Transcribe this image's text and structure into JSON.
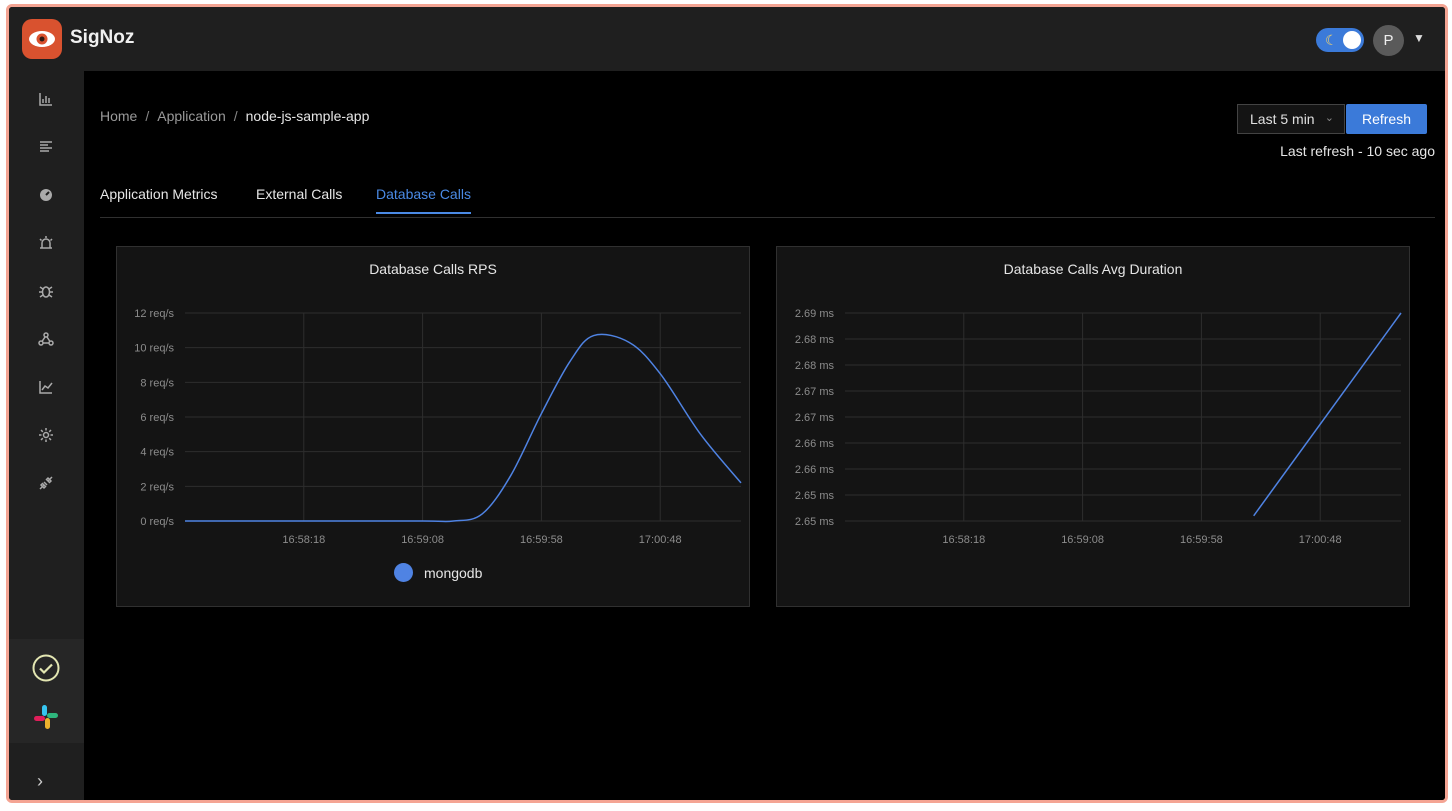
{
  "app": {
    "name": "SigNoz",
    "user_initial": "P"
  },
  "icons": {
    "logo": "eye-logo-icon",
    "theme_toggle": "moon-icon",
    "sidebar": [
      "bar-chart-icon",
      "list-icon",
      "dashboard-icon",
      "alert-icon",
      "bug-icon",
      "service-map-icon",
      "line-chart-icon",
      "settings-icon",
      "api-icon"
    ],
    "sidebar_bottom": [
      "check-circle-icon",
      "slack-icon",
      "chevron-right-icon"
    ]
  },
  "breadcrumb": [
    "Home",
    "Application",
    "node-js-sample-app"
  ],
  "time_range": {
    "selected": "Last 5 min",
    "refresh_label": "Refresh",
    "last_refresh": "Last refresh - 10 sec ago"
  },
  "tabs": [
    {
      "label": "Application Metrics",
      "active": false
    },
    {
      "label": "External Calls",
      "active": false
    },
    {
      "label": "Database Calls",
      "active": true
    }
  ],
  "colors": {
    "accent": "#3b7ad9",
    "series": "#4f83e3",
    "brand": "#d9522f"
  },
  "chart_data": [
    {
      "type": "line",
      "title": "Database Calls RPS",
      "y_ticks": [
        "0 req/s",
        "2 req/s",
        "4 req/s",
        "6 req/s",
        "8 req/s",
        "10 req/s",
        "12 req/s"
      ],
      "x_ticks": [
        "16:58:18",
        "16:59:08",
        "16:59:58",
        "17:00:48"
      ],
      "ylim": [
        0,
        12
      ],
      "grid": true,
      "legend_position": "bottom",
      "series": [
        {
          "name": "mongodb",
          "x": [
            "16:57:28",
            "16:58:18",
            "16:59:08",
            "16:59:21",
            "16:59:33",
            "16:59:45",
            "16:59:58",
            "17:00:10",
            "17:00:20",
            "17:00:35",
            "17:00:48",
            "17:01:05",
            "17:01:22"
          ],
          "values": [
            0,
            0,
            0,
            0,
            0.4,
            2.6,
            6.2,
            9.2,
            10.7,
            10.3,
            8.5,
            5.0,
            2.2
          ]
        }
      ]
    },
    {
      "type": "line",
      "title": "Database Calls Avg Duration",
      "y_ticks": [
        "2.65 ms",
        "2.65 ms",
        "2.66 ms",
        "2.66 ms",
        "2.67 ms",
        "2.67 ms",
        "2.68 ms",
        "2.68 ms",
        "2.69 ms"
      ],
      "x_ticks": [
        "16:58:18",
        "16:59:08",
        "16:59:58",
        "17:00:48"
      ],
      "ylim": [
        2.65,
        2.69
      ],
      "grid": true,
      "series": [
        {
          "x": [
            "17:00:20",
            "17:01:22"
          ],
          "values": [
            2.651,
            2.69
          ]
        }
      ]
    }
  ]
}
